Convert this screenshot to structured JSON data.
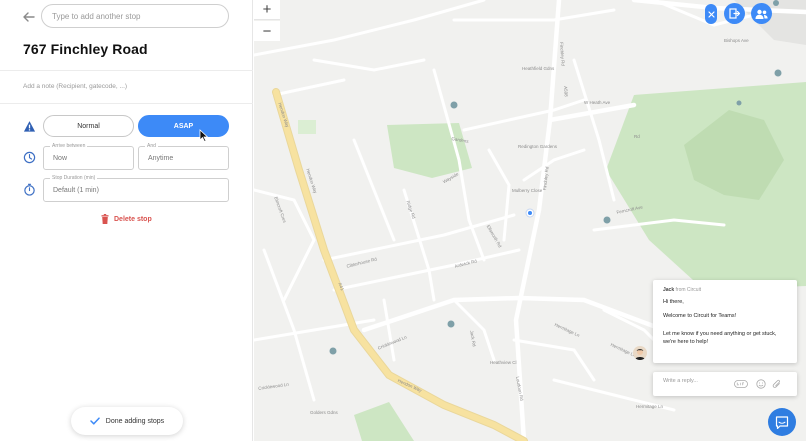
{
  "search": {
    "placeholder": "Type to add another stop"
  },
  "stop": {
    "title": "767 Finchley Road",
    "note_placeholder": "Add a note (Recipient, gatecode, ...)"
  },
  "priority": {
    "normal_label": "Normal",
    "asap_label": "ASAP",
    "selected": "ASAP"
  },
  "arrival": {
    "between_label": "Arrive between",
    "between_value": "Now",
    "and_label": "And",
    "and_value": "Anytime"
  },
  "duration": {
    "label": "Stop Duration (min)",
    "value": "Default (1 min)"
  },
  "actions": {
    "delete_label": "Delete stop",
    "done_label": "Done adding stops"
  },
  "map": {
    "zoom_in": "+",
    "zoom_out": "−",
    "streets": [
      "Hendon Way",
      "Hendon Way",
      "A41",
      "Finchley Rd",
      "Finchley Rd",
      "A598",
      "Hermitage Ln",
      "Hermitage Ln",
      "Hendon Way",
      "Cricklewood Ln",
      "Cricklewood Ln",
      "W Heath Ave",
      "Ferncroft Ave",
      "Heathfield Gdns",
      "Ridge Rd",
      "Wayside",
      "Clitterhouse Rd",
      "Ardwick Rd",
      "Rd",
      "Mulberry Close",
      "Redington Gardens",
      "Ellsworth Rd",
      "Elmcroft Cres",
      "Heathview Cl",
      "Bishops Ave",
      "Gardens",
      "Hermitage Ln",
      "Loudoun Rd",
      "Jack Rd",
      "Golders Gdns"
    ]
  },
  "colors": {
    "accent": "#3d8af7",
    "danger": "#d9534f",
    "road_major": "#f7e2a0",
    "park": "#cde6c3"
  },
  "chat": {
    "sender_name": "Jack",
    "sender_org": "from Circuit",
    "greeting": "Hi there,",
    "welcome": "Welcome to Circuit for Teams!",
    "body": "Let me know if you need anything or get stuck, we're here to help!",
    "reply_placeholder": "Write a reply..."
  }
}
